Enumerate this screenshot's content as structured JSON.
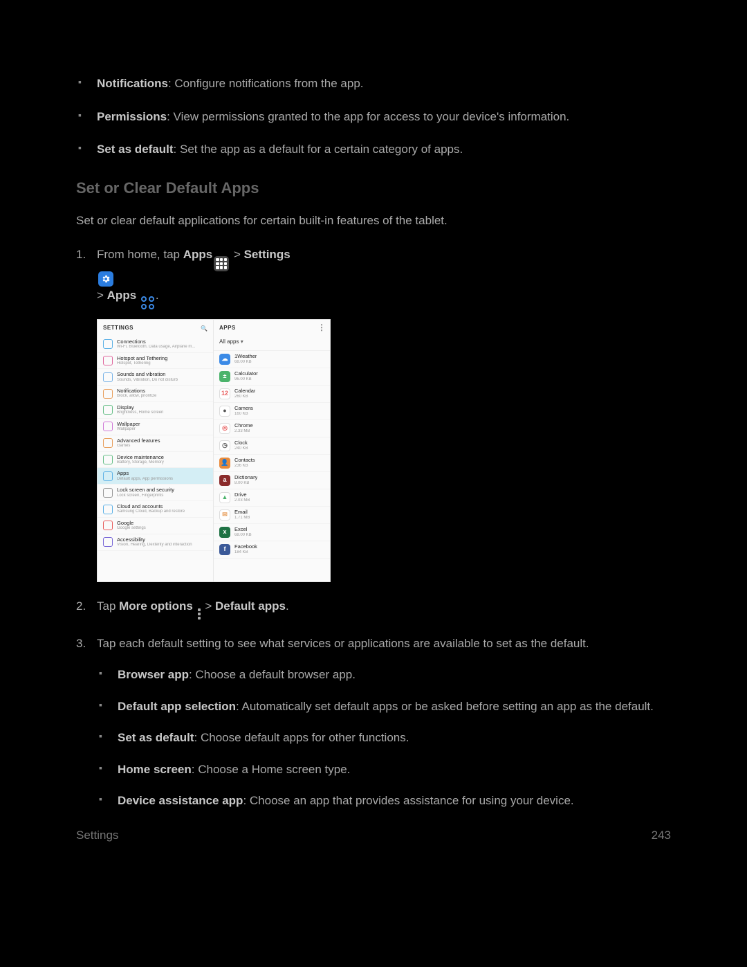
{
  "top_bullets": [
    {
      "term": "Notifications",
      "desc": ": Configure notifications from the app."
    },
    {
      "term": "Permissions",
      "desc": ": View permissions granted to the app for access to your device's information."
    },
    {
      "term": "Set as default",
      "desc": ": Set the app as a default for a certain category of apps."
    }
  ],
  "section": {
    "title": "Set or Clear Default Apps",
    "desc": "Set or clear default applications for certain built-in features of the tablet."
  },
  "steps": {
    "s1": {
      "prefix": "From home, tap ",
      "apps": "Apps",
      "gt1": " > ",
      "settings": "Settings",
      "gt2": " > ",
      "apps2": "Apps",
      "suffix": "."
    },
    "s2": {
      "prefix": "Tap ",
      "more": "More options",
      "gt": " > ",
      "default_apps": "Default apps",
      "suffix": "."
    },
    "s3": "Tap each default setting to see what services or applications are available to set as the default."
  },
  "sub_bullets": [
    {
      "term": "Browser app",
      "desc": ": Choose a default browser app."
    },
    {
      "term": "Default app selection",
      "desc": ": Automatically set default apps or be asked before setting an app as the default."
    },
    {
      "term": "Set as default",
      "desc": ": Choose default apps for other functions."
    },
    {
      "term": "Home screen",
      "desc": ": Choose a Home screen type."
    },
    {
      "term": "Device assistance app",
      "desc": ": Choose an app that provides assistance for using your device."
    }
  ],
  "screenshot": {
    "left_header": "SETTINGS",
    "right_header": "APPS",
    "filter": "All apps",
    "settings_rows": [
      {
        "name": "Connections",
        "sub": "Wi-Fi, Bluetooth, Data usage, Airplane m...",
        "color": "#5fb2e6"
      },
      {
        "name": "Hotspot and Tethering",
        "sub": "Hotspot, Tethering",
        "color": "#e06aa0"
      },
      {
        "name": "Sounds and vibration",
        "sub": "Sounds, Vibration, Do not disturb",
        "color": "#7bb4e8"
      },
      {
        "name": "Notifications",
        "sub": "Block, allow, prioritize",
        "color": "#e8a05f"
      },
      {
        "name": "Display",
        "sub": "Brightness, Home screen",
        "color": "#6ac08a"
      },
      {
        "name": "Wallpaper",
        "sub": "Wallpaper",
        "color": "#d07bd8"
      },
      {
        "name": "Advanced features",
        "sub": "Games",
        "color": "#e8a05f"
      },
      {
        "name": "Device maintenance",
        "sub": "Battery, Storage, Memory",
        "color": "#6ac08a"
      },
      {
        "name": "Apps",
        "sub": "Default apps, App permissions",
        "color": "#5fb2e6",
        "selected": true
      },
      {
        "name": "Lock screen and security",
        "sub": "Lock screen, Fingerprints",
        "color": "#999"
      },
      {
        "name": "Cloud and accounts",
        "sub": "Samsung Cloud, Backup and restore",
        "color": "#5fb2e6"
      },
      {
        "name": "Google",
        "sub": "Google settings",
        "color": "#e85f5f"
      },
      {
        "name": "Accessibility",
        "sub": "Vision, Hearing, Dexterity and interaction",
        "color": "#7b6ad8"
      }
    ],
    "app_rows": [
      {
        "name": "1Weather",
        "sub": "68.00 KB",
        "color": "#3b8ae6",
        "glyph": "☁"
      },
      {
        "name": "Calculator",
        "sub": "96.00 KB",
        "color": "#4bb36b",
        "glyph": "±"
      },
      {
        "name": "Calendar",
        "sub": "260 KB",
        "color": "#ffffff",
        "glyph": "12",
        "txt": "#e85f5f"
      },
      {
        "name": "Camera",
        "sub": "160 KB",
        "color": "#ffffff",
        "glyph": "●",
        "txt": "#555"
      },
      {
        "name": "Chrome",
        "sub": "2.33 MB",
        "color": "#ffffff",
        "glyph": "◎",
        "txt": "#e85f5f"
      },
      {
        "name": "Clock",
        "sub": "240 KB",
        "color": "#ffffff",
        "glyph": "◷",
        "txt": "#555"
      },
      {
        "name": "Contacts",
        "sub": "236 KB",
        "color": "#e88a3b",
        "glyph": "👤"
      },
      {
        "name": "Dictionary",
        "sub": "8.00 KB",
        "color": "#8a2b2b",
        "glyph": "a"
      },
      {
        "name": "Drive",
        "sub": "2.03 MB",
        "color": "#ffffff",
        "glyph": "▲",
        "txt": "#4bb36b"
      },
      {
        "name": "Email",
        "sub": "1.71 MB",
        "color": "#ffffff",
        "glyph": "✉",
        "txt": "#e8a05f"
      },
      {
        "name": "Excel",
        "sub": "68.00 KB",
        "color": "#1f7244",
        "glyph": "x"
      },
      {
        "name": "Facebook",
        "sub": "184 KB",
        "color": "#3b5998",
        "glyph": "f"
      }
    ]
  },
  "footer": {
    "left": "Settings",
    "right": "243"
  }
}
